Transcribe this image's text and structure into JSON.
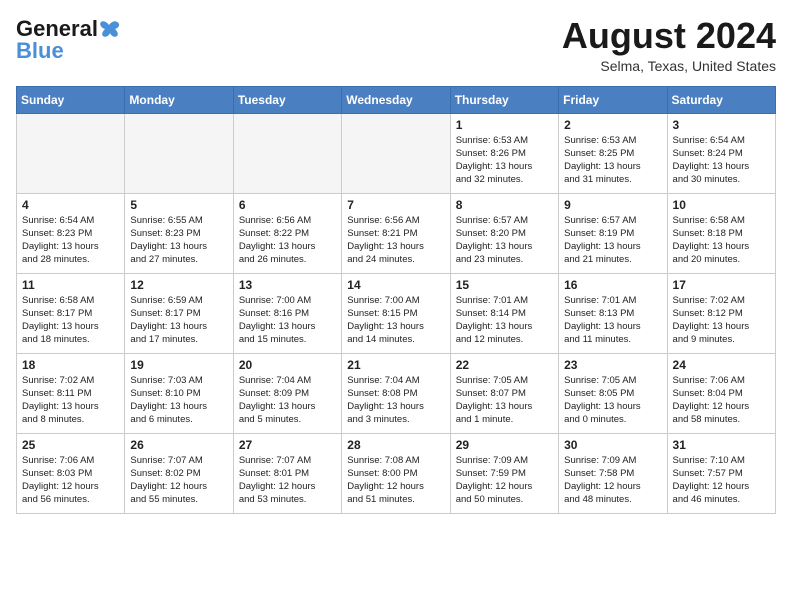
{
  "header": {
    "logo_general": "General",
    "logo_blue": "Blue",
    "month_title": "August 2024",
    "location": "Selma, Texas, United States"
  },
  "days_of_week": [
    "Sunday",
    "Monday",
    "Tuesday",
    "Wednesday",
    "Thursday",
    "Friday",
    "Saturday"
  ],
  "weeks": [
    [
      {
        "day": "",
        "info": ""
      },
      {
        "day": "",
        "info": ""
      },
      {
        "day": "",
        "info": ""
      },
      {
        "day": "",
        "info": ""
      },
      {
        "day": "1",
        "info": "Sunrise: 6:53 AM\nSunset: 8:26 PM\nDaylight: 13 hours\nand 32 minutes."
      },
      {
        "day": "2",
        "info": "Sunrise: 6:53 AM\nSunset: 8:25 PM\nDaylight: 13 hours\nand 31 minutes."
      },
      {
        "day": "3",
        "info": "Sunrise: 6:54 AM\nSunset: 8:24 PM\nDaylight: 13 hours\nand 30 minutes."
      }
    ],
    [
      {
        "day": "4",
        "info": "Sunrise: 6:54 AM\nSunset: 8:23 PM\nDaylight: 13 hours\nand 28 minutes."
      },
      {
        "day": "5",
        "info": "Sunrise: 6:55 AM\nSunset: 8:23 PM\nDaylight: 13 hours\nand 27 minutes."
      },
      {
        "day": "6",
        "info": "Sunrise: 6:56 AM\nSunset: 8:22 PM\nDaylight: 13 hours\nand 26 minutes."
      },
      {
        "day": "7",
        "info": "Sunrise: 6:56 AM\nSunset: 8:21 PM\nDaylight: 13 hours\nand 24 minutes."
      },
      {
        "day": "8",
        "info": "Sunrise: 6:57 AM\nSunset: 8:20 PM\nDaylight: 13 hours\nand 23 minutes."
      },
      {
        "day": "9",
        "info": "Sunrise: 6:57 AM\nSunset: 8:19 PM\nDaylight: 13 hours\nand 21 minutes."
      },
      {
        "day": "10",
        "info": "Sunrise: 6:58 AM\nSunset: 8:18 PM\nDaylight: 13 hours\nand 20 minutes."
      }
    ],
    [
      {
        "day": "11",
        "info": "Sunrise: 6:58 AM\nSunset: 8:17 PM\nDaylight: 13 hours\nand 18 minutes."
      },
      {
        "day": "12",
        "info": "Sunrise: 6:59 AM\nSunset: 8:17 PM\nDaylight: 13 hours\nand 17 minutes."
      },
      {
        "day": "13",
        "info": "Sunrise: 7:00 AM\nSunset: 8:16 PM\nDaylight: 13 hours\nand 15 minutes."
      },
      {
        "day": "14",
        "info": "Sunrise: 7:00 AM\nSunset: 8:15 PM\nDaylight: 13 hours\nand 14 minutes."
      },
      {
        "day": "15",
        "info": "Sunrise: 7:01 AM\nSunset: 8:14 PM\nDaylight: 13 hours\nand 12 minutes."
      },
      {
        "day": "16",
        "info": "Sunrise: 7:01 AM\nSunset: 8:13 PM\nDaylight: 13 hours\nand 11 minutes."
      },
      {
        "day": "17",
        "info": "Sunrise: 7:02 AM\nSunset: 8:12 PM\nDaylight: 13 hours\nand 9 minutes."
      }
    ],
    [
      {
        "day": "18",
        "info": "Sunrise: 7:02 AM\nSunset: 8:11 PM\nDaylight: 13 hours\nand 8 minutes."
      },
      {
        "day": "19",
        "info": "Sunrise: 7:03 AM\nSunset: 8:10 PM\nDaylight: 13 hours\nand 6 minutes."
      },
      {
        "day": "20",
        "info": "Sunrise: 7:04 AM\nSunset: 8:09 PM\nDaylight: 13 hours\nand 5 minutes."
      },
      {
        "day": "21",
        "info": "Sunrise: 7:04 AM\nSunset: 8:08 PM\nDaylight: 13 hours\nand 3 minutes."
      },
      {
        "day": "22",
        "info": "Sunrise: 7:05 AM\nSunset: 8:07 PM\nDaylight: 13 hours\nand 1 minute."
      },
      {
        "day": "23",
        "info": "Sunrise: 7:05 AM\nSunset: 8:05 PM\nDaylight: 13 hours\nand 0 minutes."
      },
      {
        "day": "24",
        "info": "Sunrise: 7:06 AM\nSunset: 8:04 PM\nDaylight: 12 hours\nand 58 minutes."
      }
    ],
    [
      {
        "day": "25",
        "info": "Sunrise: 7:06 AM\nSunset: 8:03 PM\nDaylight: 12 hours\nand 56 minutes."
      },
      {
        "day": "26",
        "info": "Sunrise: 7:07 AM\nSunset: 8:02 PM\nDaylight: 12 hours\nand 55 minutes."
      },
      {
        "day": "27",
        "info": "Sunrise: 7:07 AM\nSunset: 8:01 PM\nDaylight: 12 hours\nand 53 minutes."
      },
      {
        "day": "28",
        "info": "Sunrise: 7:08 AM\nSunset: 8:00 PM\nDaylight: 12 hours\nand 51 minutes."
      },
      {
        "day": "29",
        "info": "Sunrise: 7:09 AM\nSunset: 7:59 PM\nDaylight: 12 hours\nand 50 minutes."
      },
      {
        "day": "30",
        "info": "Sunrise: 7:09 AM\nSunset: 7:58 PM\nDaylight: 12 hours\nand 48 minutes."
      },
      {
        "day": "31",
        "info": "Sunrise: 7:10 AM\nSunset: 7:57 PM\nDaylight: 12 hours\nand 46 minutes."
      }
    ]
  ]
}
